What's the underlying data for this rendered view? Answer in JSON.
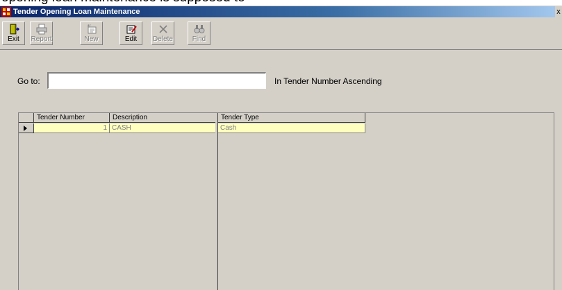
{
  "background_text": "opening loan maintenance is supposed to",
  "window": {
    "title": "Tender Opening Loan Maintenance",
    "close_label": "x"
  },
  "toolbar": {
    "buttons": [
      {
        "label": "Exit",
        "icon": "exit-door-icon",
        "enabled": true
      },
      {
        "label": "Report",
        "icon": "printer-icon",
        "enabled": false
      },
      {
        "label": "New",
        "icon": "new-record-icon",
        "enabled": false
      },
      {
        "label": "Edit",
        "icon": "edit-record-icon",
        "enabled": true
      },
      {
        "label": "Delete",
        "icon": "delete-x-icon",
        "enabled": false
      },
      {
        "label": "Find",
        "icon": "binoculars-icon",
        "enabled": false
      }
    ]
  },
  "goto": {
    "label": "Go to:",
    "value": "",
    "sort_text": "In Tender Number Ascending"
  },
  "grid": {
    "columns": [
      "Tender Number",
      "Description",
      "Tender Type"
    ],
    "rows": [
      {
        "tender_number": "1",
        "description": "CASH",
        "tender_type": "Cash"
      }
    ]
  },
  "colors": {
    "title_gradient_start": "#0a246a",
    "row_highlight": "#ffffc0",
    "face": "#d4d0c8"
  }
}
